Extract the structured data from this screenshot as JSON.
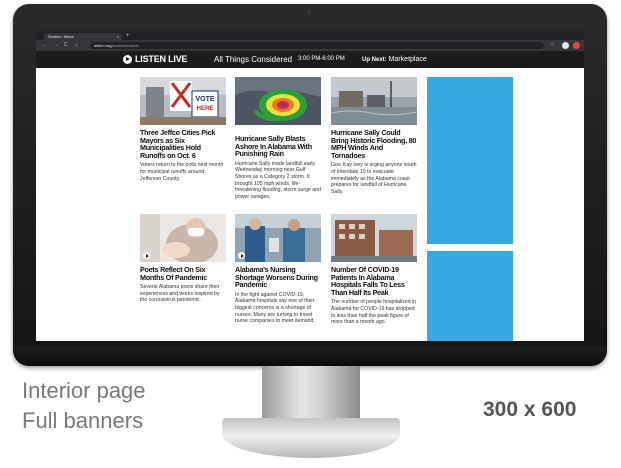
{
  "browser": {
    "tab_title": "Section: News",
    "tab_close": "×",
    "new_tab": "+",
    "url_host": "wbhm.org",
    "url_path": "/sections/news/",
    "back": "←",
    "forward": "→",
    "reload": "C",
    "home": "⌂",
    "bookmark_star": "☆"
  },
  "live_bar": {
    "listen_label": "LISTEN LIVE",
    "program": "All Things Considered",
    "time": "3:00 PM-6:00 PM",
    "up_next_label": "Up Next:",
    "up_next_program": "Marketplace"
  },
  "stories": [
    {
      "headline": "Three Jeffco Cities Pick Mayors as Six Municipalities Hold Runoffs on Oct. 6",
      "blurb": "Voters return to the polls next month for municipal runoffs around Jefferson County.",
      "image": "vote-sign-photo"
    },
    {
      "headline": "Hurricane Sally Blasts Ashore In Alabama With Punishing Rain",
      "blurb": "Hurricane Sally made landfall early Wednesday morning near Gulf Shores as a Category 2 storm. It brought 105 mph winds, life-threatening flooding, storm surge and power outages.",
      "image": "radar-map"
    },
    {
      "headline": "Hurricane Sally Could Bring Historic Flooding, 80 MPH Winds And Tornadoes",
      "blurb": "Gov. Kay Ivey is urging anyone south of Interstate 10 to evacuate immediately as the Alabama coast prepares for landfall of Hurricane Sally.",
      "image": "coastal-storm-photo"
    },
    {
      "headline": "Poets Reflect On Six Months Of Pandemic",
      "blurb": "Several Alabama poets share their experiences and works inspired by the coronavirus pandemic.",
      "image": "masked-caregiver-photo"
    },
    {
      "headline": "Alabama's Nursing Shortage Worsens During Pandemic",
      "blurb": "In the fight against COVID-19, Alabama hospitals say one of their biggest concerns is a shortage of nurses. Many are turning to travel nurse companies to meet demand.",
      "image": "nurses-photo"
    },
    {
      "headline": "Number Of COVID-19 Patients In Alabama Hospitals Falls To Less Than Half Its Peak",
      "blurb": "The number of people hospitalized in Alabama for COVID-19 has dropped to less than half the peak figure of more than a month ago.",
      "image": "hospital-building-photo"
    }
  ],
  "ads": [
    {
      "color": "#36a8e2"
    },
    {
      "color": "#36a8e2"
    }
  ],
  "captions": {
    "line1": "Interior page",
    "line2": "Full banners",
    "size": "300 x 600"
  },
  "colors": {
    "ad_blue": "#36a8e2",
    "header_bg": "#1b1b1b",
    "caption_gray": "#7a7a7a"
  }
}
